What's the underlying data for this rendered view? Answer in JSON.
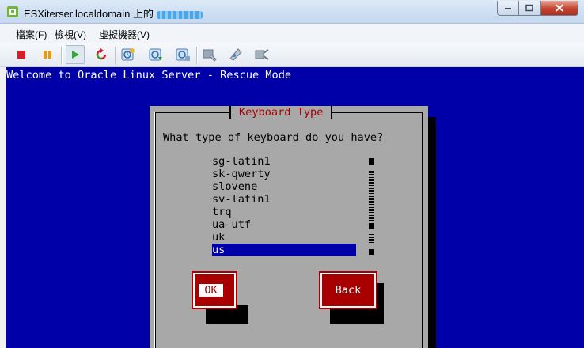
{
  "window": {
    "title": "ESXiterser.localdomain 上的",
    "title_redacted_name": "(obscured vm name)",
    "accent": "#c4d7ee"
  },
  "menu": [
    {
      "label": "檔案(F)"
    },
    {
      "label": "檢視(V)"
    },
    {
      "label": "虛擬機器(V)"
    }
  ],
  "toolbar": {
    "buttons": [
      {
        "icon": "stop-icon",
        "color": "#d4202a"
      },
      {
        "icon": "pause-icon",
        "color": "#e79a10"
      },
      {
        "icon": "play-icon",
        "color": "#2eaa2e"
      },
      {
        "icon": "reset-icon",
        "color": "#d4202a"
      },
      {
        "icon": "snapshot-take-icon"
      },
      {
        "icon": "snapshot-revert-icon"
      },
      {
        "icon": "snapshot-manager-icon"
      },
      {
        "icon": "vm-settings-icon"
      },
      {
        "icon": "console-options-icon"
      },
      {
        "icon": "connect-device-icon"
      }
    ]
  },
  "console": {
    "header": "Welcome to Oracle Linux Server - Rescue Mode",
    "background": "#0000a8",
    "dialog": {
      "title": "Keyboard Type",
      "question": "What type of keyboard do you have?",
      "items": [
        "sg-latin1",
        "sk-qwerty",
        "slovene",
        "sv-latin1",
        "trq",
        "ua-utf",
        "uk",
        "us"
      ],
      "selected": "us",
      "ok_label": "OK",
      "back_label": "Back"
    }
  }
}
